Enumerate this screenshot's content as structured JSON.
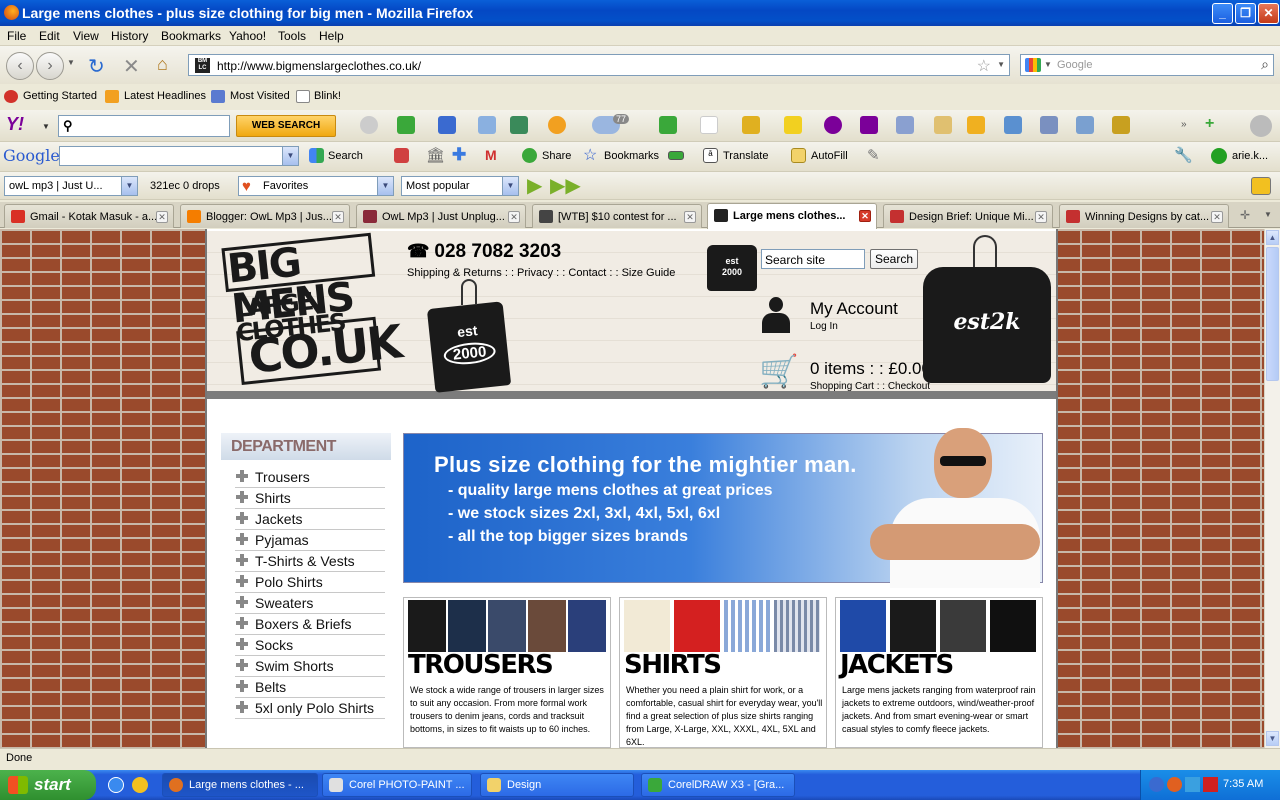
{
  "window": {
    "title": "Large mens clothes - plus size clothing for big men - Mozilla Firefox",
    "min": "_",
    "max": "❐",
    "close": "✕"
  },
  "menu": [
    "File",
    "Edit",
    "View",
    "History",
    "Bookmarks",
    "Yahoo!",
    "Tools",
    "Help"
  ],
  "nav": {
    "url": "http://www.bigmenslargeclothes.co.uk/",
    "search_placeholder": "Google",
    "favicon_text": "BM LC"
  },
  "bookmarks": [
    "Getting Started",
    "Latest Headlines",
    "Most Visited",
    "Blink!"
  ],
  "yahoo_bar": {
    "web_search": "WEB SEARCH",
    "badge": "77"
  },
  "google_bar": {
    "logo": "Google",
    "search": "Search",
    "share": "Share",
    "bookmarks": "Bookmarks",
    "translate": "Translate",
    "autofill": "AutoFill",
    "user": "arie.k..."
  },
  "owl_bar": {
    "combo1": "owL mp3 | Just U...",
    "drops": "321ec 0 drops",
    "favorites": "Favorites",
    "popular": "Most popular"
  },
  "tabs": [
    {
      "label": "Gmail - Kotak Masuk - a...",
      "color": "#d93025"
    },
    {
      "label": "Blogger: OwL Mp3 | Jus...",
      "color": "#f57d00"
    },
    {
      "label": "OwL Mp3 | Just Unplug...",
      "color": "#8a2a3a"
    },
    {
      "label": "[WTB] $10 contest for ...",
      "color": "#444444"
    },
    {
      "label": "Large mens clothes...",
      "color": "#222222",
      "active": true
    },
    {
      "label": "Design Brief: Unique Mi...",
      "color": "#c43030"
    },
    {
      "label": "Winning Designs by cat...",
      "color": "#c43030"
    }
  ],
  "site": {
    "logo_line1": "BIG MENS",
    "logo_line2": "LARGE CLOTHES",
    "logo_line3": "CO.UK",
    "est_label": "est",
    "est_year": "2000",
    "est_year2": "2000",
    "est2k": "est2k",
    "phone": "028 7082 3203",
    "toplinks": "Shipping & Returns : : Privacy : : Contact : : Size Guide",
    "search_placeholder": "Search site",
    "search_button": "Search",
    "account_title": "My Account",
    "login": "Log In",
    "cart": "0  items : : £0.00",
    "cart_links": "Shopping Cart : : Checkout"
  },
  "department": {
    "title": "DEPARTMENT",
    "items": [
      "Trousers",
      "Shirts",
      "Jackets",
      "Pyjamas",
      "T-Shirts & Vests",
      "Polo Shirts",
      "Sweaters",
      "Boxers & Briefs",
      "Socks",
      "Swim Shorts",
      "Belts",
      "5xl only Polo Shirts"
    ]
  },
  "banner": {
    "headline": "Plus size clothing for the mightier man.",
    "points": [
      "- quality large mens clothes at great prices",
      "- we stock sizes 2xl, 3xl, 4xl, 5xl, 6xl",
      "- all the top bigger sizes brands"
    ]
  },
  "tiles": [
    {
      "title": "TROUSERS",
      "desc": "We stock a wide range of trousers in larger sizes to suit any occasion. From more formal work trousers to denim jeans, cords and tracksuit bottoms, in sizes to fit waists up to 60 inches.",
      "colors": [
        "#1a1a1a",
        "#1d2f4a",
        "#3a4a6a",
        "#6a4a3a",
        "#2a3f7a"
      ]
    },
    {
      "title": "SHIRTS",
      "desc": "Whether you need a plain shirt for work, or a comfortable, casual shirt for everyday wear, you'll find a great selection of plus size shirts ranging from Large, X-Large, XXL, XXXL, 4XL, 5XL and 6XL.",
      "colors": [
        "#f2ead6",
        "#d42020",
        "#8aa8d8",
        "#7a8aa8"
      ]
    },
    {
      "title": "JACKETS",
      "desc": "Large mens jackets ranging from waterproof rain jackets to extreme outdoors, wind/weather-proof jackets. And from smart evening-wear or smart casual styles to comfy fleece jackets.",
      "colors": [
        "#1f4aa8",
        "#1a1a1a",
        "#3a3a3a",
        "#101010"
      ]
    }
  ],
  "status": "Done",
  "taskbar": {
    "start": "start",
    "tasks": [
      "Large mens clothes - ...",
      "Corel PHOTO-PAINT ...",
      "Design",
      "CorelDRAW X3 - [Gra..."
    ],
    "clock": "7:35 AM"
  }
}
